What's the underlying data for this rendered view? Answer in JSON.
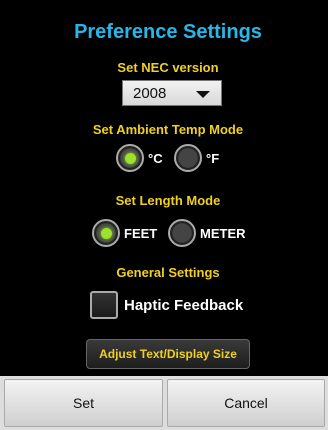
{
  "dialog": {
    "title": "Preference Settings"
  },
  "nec": {
    "label": "Set NEC version",
    "selected": "2008"
  },
  "temp": {
    "label": "Set Ambient Temp Mode",
    "options": [
      {
        "label": "°C",
        "selected": true
      },
      {
        "label": "°F",
        "selected": false
      }
    ]
  },
  "length": {
    "label": "Set Length Mode",
    "options": [
      {
        "label": "FEET",
        "selected": true
      },
      {
        "label": "METER",
        "selected": false
      }
    ]
  },
  "general": {
    "label": "General Settings",
    "haptic_label": "Haptic Feedback",
    "haptic_checked": false,
    "adjust_label": "Adjust Text/Display Size"
  },
  "footer": {
    "set_label": "Set",
    "cancel_label": "Cancel"
  },
  "colors": {
    "title": "#27b6e8",
    "section_label": "#f0d020",
    "radio_on": "#9be22a"
  }
}
